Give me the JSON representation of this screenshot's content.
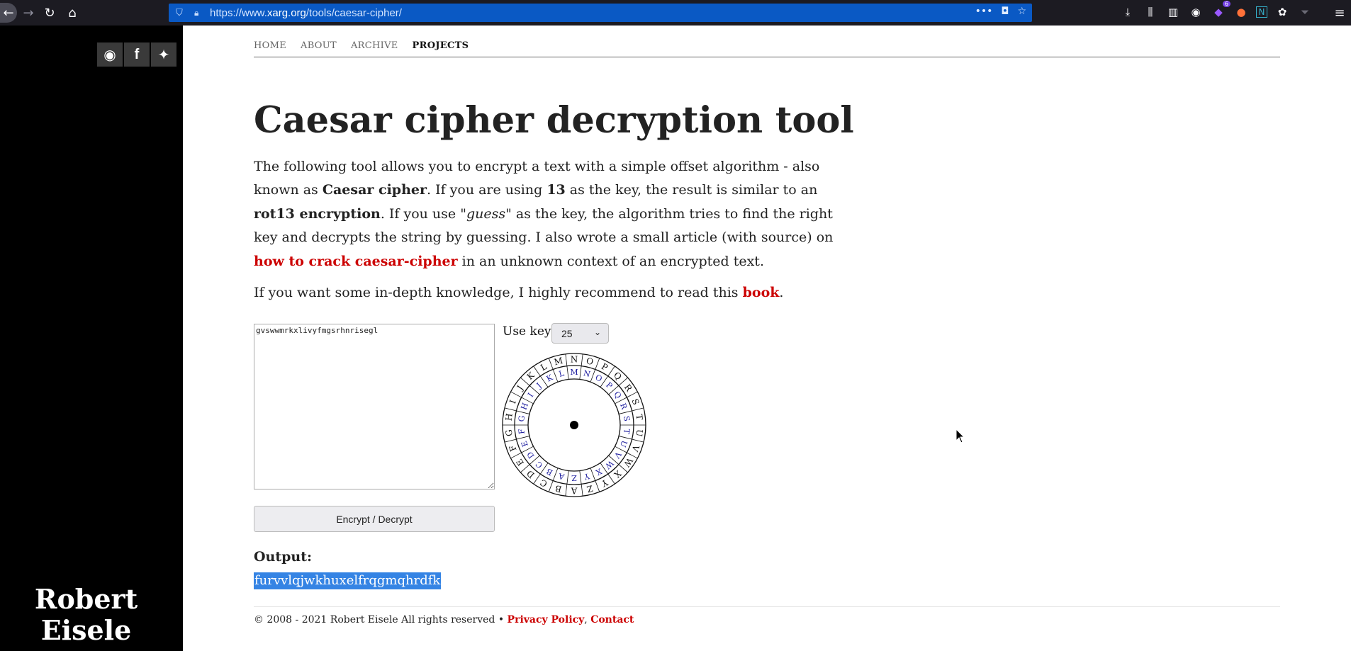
{
  "browser": {
    "url_prefix": "https://www.",
    "url_domain": "xarg.org",
    "url_path": "/tools/caesar-cipher/",
    "extension_badge": "6"
  },
  "sidebar": {
    "social": [
      "github-icon",
      "facebook-icon",
      "twitter-icon"
    ],
    "author_line1": "Robert",
    "author_line2": "Eisele"
  },
  "nav": {
    "items": [
      {
        "label": "HOME"
      },
      {
        "label": "ABOUT"
      },
      {
        "label": "ARCHIVE"
      },
      {
        "label": "PROJECTS"
      }
    ]
  },
  "page": {
    "title": "Caesar cipher decryption tool",
    "intro": {
      "t1": "The following tool allows you to encrypt a text with a simple offset algorithm - also known as ",
      "b1": "Caesar cipher",
      "t2": ". If you are using ",
      "b2": "13",
      "t3": " as the key, the result is similar to an ",
      "b3": "rot13 encryption",
      "t4": ". If you use ",
      "i1": "\"guess\"",
      "t5": " as the key, the algorithm tries to find the right key and decrypts the string by guessing. I also wrote a small article (with source) on ",
      "link": "how to crack caesar-cipher",
      "t6": " in an unknown context of an encrypted text."
    },
    "para2": {
      "t1": "If you want some in-depth knowledge, I highly recommend to read this ",
      "link": "book",
      "t2": "."
    }
  },
  "tool": {
    "input_text": "gvswwmrkxlivyfmgsrhnrisegl",
    "key_label": "Use key:",
    "key_value": "25",
    "button_label": "Encrypt / Decrypt",
    "output_label": "Output:",
    "output_value": "furvvlqjwkhuxelfrqgmqhrdfk",
    "wheel_outer": [
      "A",
      "B",
      "C",
      "D",
      "E",
      "F",
      "G",
      "H",
      "I",
      "J",
      "K",
      "L",
      "M",
      "N",
      "O",
      "P",
      "Q",
      "R",
      "S",
      "T",
      "U",
      "V",
      "W",
      "X",
      "Y",
      "Z"
    ],
    "wheel_inner": [
      "Z",
      "A",
      "B",
      "C",
      "D",
      "E",
      "F",
      "G",
      "H",
      "I",
      "J",
      "K",
      "L",
      "M",
      "N",
      "O",
      "P",
      "Q",
      "R",
      "S",
      "T",
      "U",
      "V",
      "W",
      "X",
      "Y"
    ],
    "wheel_inner_color": "#2020a0"
  },
  "footer": {
    "text": "© 2008 - 2021 Robert Eisele All rights reserved • ",
    "privacy": "Privacy Policy",
    "sep": ", ",
    "contact": "Contact"
  }
}
